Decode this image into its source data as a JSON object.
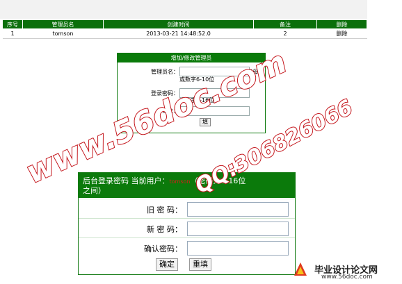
{
  "admin_table": {
    "headers": [
      "序号",
      "管理员名",
      "创建时间",
      "备注",
      "删除"
    ],
    "rows": [
      {
        "no": "1",
        "name": "tomson",
        "created": "2013-03-21 14:48:52.0",
        "note": "2",
        "action": "删除"
      }
    ]
  },
  "admin_form": {
    "title": "增加/修改管理员",
    "name_label": "管理员名：",
    "name_hint_a": "字母",
    "name_hint_b": "或数字6-10位",
    "pwd_label": "登录密码：",
    "pwd_hint_a": "或数字6-16位",
    "note_label": "备注：",
    "submit_label": "填"
  },
  "password_form": {
    "header_line1_a": "后台登录密码 当前用户：",
    "current_user": "tomson",
    "header_line1_b": "（密码为6-16位",
    "header_line2": "之间）",
    "old_label": "旧 密 码：",
    "new_label": "新 密 码：",
    "confirm_label": "确认密码：",
    "ok_label": "确定",
    "reset_label": "重填"
  },
  "watermarks": {
    "site": "www.56doc.com",
    "qq": "QQ:306826066"
  },
  "logo": {
    "name": "毕业设计论文网",
    "url": "www.56doc.com"
  },
  "colors": {
    "header_green": "#0b6f0b",
    "watermark_red": "#c4161c"
  }
}
